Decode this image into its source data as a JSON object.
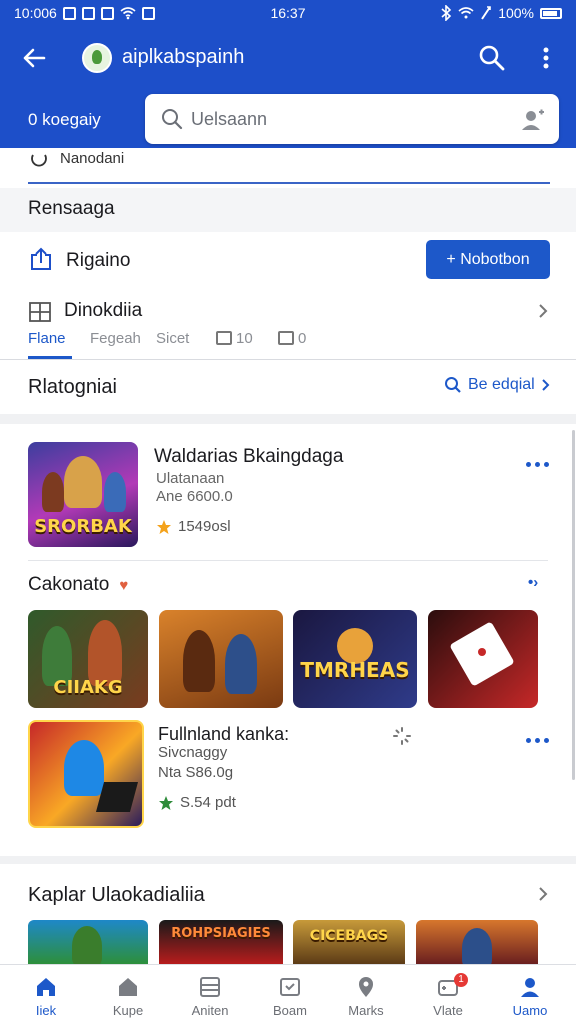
{
  "status_bar": {
    "time_left": "10:006",
    "time_center": "16:37",
    "battery": "100%"
  },
  "header": {
    "title": "aiplkabspainh",
    "location": "0 koegaiy",
    "search_placeholder": "Uelsaann"
  },
  "filters": {
    "hint": "Nanodani",
    "section_title": "Rensaaga",
    "region_label": "Rigaino",
    "region_button": "+ Nobotbon",
    "category_label": "Dinokdiia",
    "tabs": [
      {
        "label": "Flane",
        "active": true
      },
      {
        "label": "Fegeah",
        "active": false
      },
      {
        "label": "Sicet",
        "active": false
      },
      {
        "label": "10",
        "active": false
      },
      {
        "label": "0",
        "active": false
      }
    ]
  },
  "recommended": {
    "title": "Rlatogniai",
    "see_all": "Be edqial"
  },
  "app1": {
    "name": "Waldarias Bkaingdaga",
    "developer": "Ulatanaan",
    "size": "Ane 6600.0",
    "rating": "1549osl",
    "thumb_text": "SRORBAK"
  },
  "subsection": {
    "title": "Cakonato",
    "more": "•›",
    "thumbs": [
      {
        "label": "CIIAKG",
        "colors": [
          "#2f5a2b",
          "#7a3b1f"
        ]
      },
      {
        "label": "",
        "colors": [
          "#7a3a12",
          "#d9822b"
        ]
      },
      {
        "label": "TMRHEAS",
        "colors": [
          "#1a1740",
          "#2f3b8a"
        ]
      },
      {
        "label": "",
        "colors": [
          "#2b0d0d",
          "#c62828"
        ]
      }
    ]
  },
  "app2": {
    "name": "Fullnland kanka:",
    "developer": "Sivcnaggy",
    "size": "Nta S86.0g",
    "rating": "S.54 pdt"
  },
  "bottom_section": {
    "title": "Kaplar Ulaokadialiia",
    "thumbs": [
      {
        "label": "",
        "colors": [
          "#1e4c7a",
          "#2d8f3a"
        ]
      },
      {
        "label": "ROHPSIAGIES",
        "colors": [
          "#1a1a1a",
          "#b71c1c"
        ]
      },
      {
        "label": "CICEBAGS",
        "colors": [
          "#5c3b16",
          "#c79a3a"
        ]
      },
      {
        "label": "",
        "colors": [
          "#6a1f1f",
          "#d7772d"
        ]
      }
    ]
  },
  "nav": [
    {
      "label": "Iiek",
      "icon": "home-icon",
      "active": true
    },
    {
      "label": "Kupe",
      "icon": "house-icon",
      "active": false
    },
    {
      "label": "Aniten",
      "icon": "list-icon",
      "active": false
    },
    {
      "label": "Boam",
      "icon": "clipboard-icon",
      "active": false
    },
    {
      "label": "Marks",
      "icon": "pin-icon",
      "active": false
    },
    {
      "label": "Vlate",
      "icon": "gamepad-icon",
      "active": false,
      "badge": "1"
    },
    {
      "label": "Uamo",
      "icon": "person-icon",
      "active": true
    }
  ]
}
